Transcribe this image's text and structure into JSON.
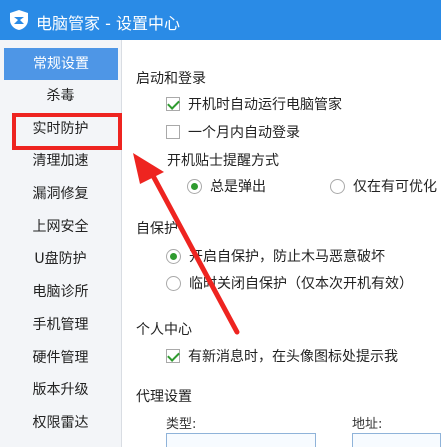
{
  "window": {
    "title": "电脑管家 - 设置中心"
  },
  "sidebar": {
    "items": [
      {
        "label": "常规设置",
        "active": true
      },
      {
        "label": "杀毒"
      },
      {
        "label": "实时防护"
      },
      {
        "label": "清理加速"
      },
      {
        "label": "漏洞修复"
      },
      {
        "label": "上网安全"
      },
      {
        "label": "U盘防护"
      },
      {
        "label": "电脑诊所"
      },
      {
        "label": "手机管理"
      },
      {
        "label": "硬件管理"
      },
      {
        "label": "版本升级"
      },
      {
        "label": "权限雷达"
      }
    ]
  },
  "main": {
    "startup": {
      "heading": "启动和登录",
      "autorun": {
        "label": "开机时自动运行电脑管家",
        "checked": true
      },
      "autologin": {
        "label": "一个月内自动登录",
        "checked": false
      },
      "tip_heading": "开机贴士提醒方式",
      "tip_always": {
        "label": "总是弹出",
        "selected": true
      },
      "tip_new": {
        "label": "仅在有可优化",
        "selected": false
      }
    },
    "selfprotect": {
      "heading": "自保护",
      "on": {
        "label": "开启自保护，防止木马恶意破坏",
        "selected": true
      },
      "off": {
        "label": "临时关闭自保护（仅本次开机有效）",
        "selected": false
      }
    },
    "personal": {
      "heading": "个人中心",
      "notify": {
        "label": "有新消息时，在头像图标处提示我",
        "checked": true
      }
    },
    "proxy": {
      "heading": "代理设置",
      "type_label": "类型:",
      "address_label": "地址:"
    }
  },
  "colors": {
    "titlebar": "#2a8be6",
    "sidebar_active": "#4e96e6",
    "annotation": "#ee2420",
    "check": "#2f9b2f"
  }
}
